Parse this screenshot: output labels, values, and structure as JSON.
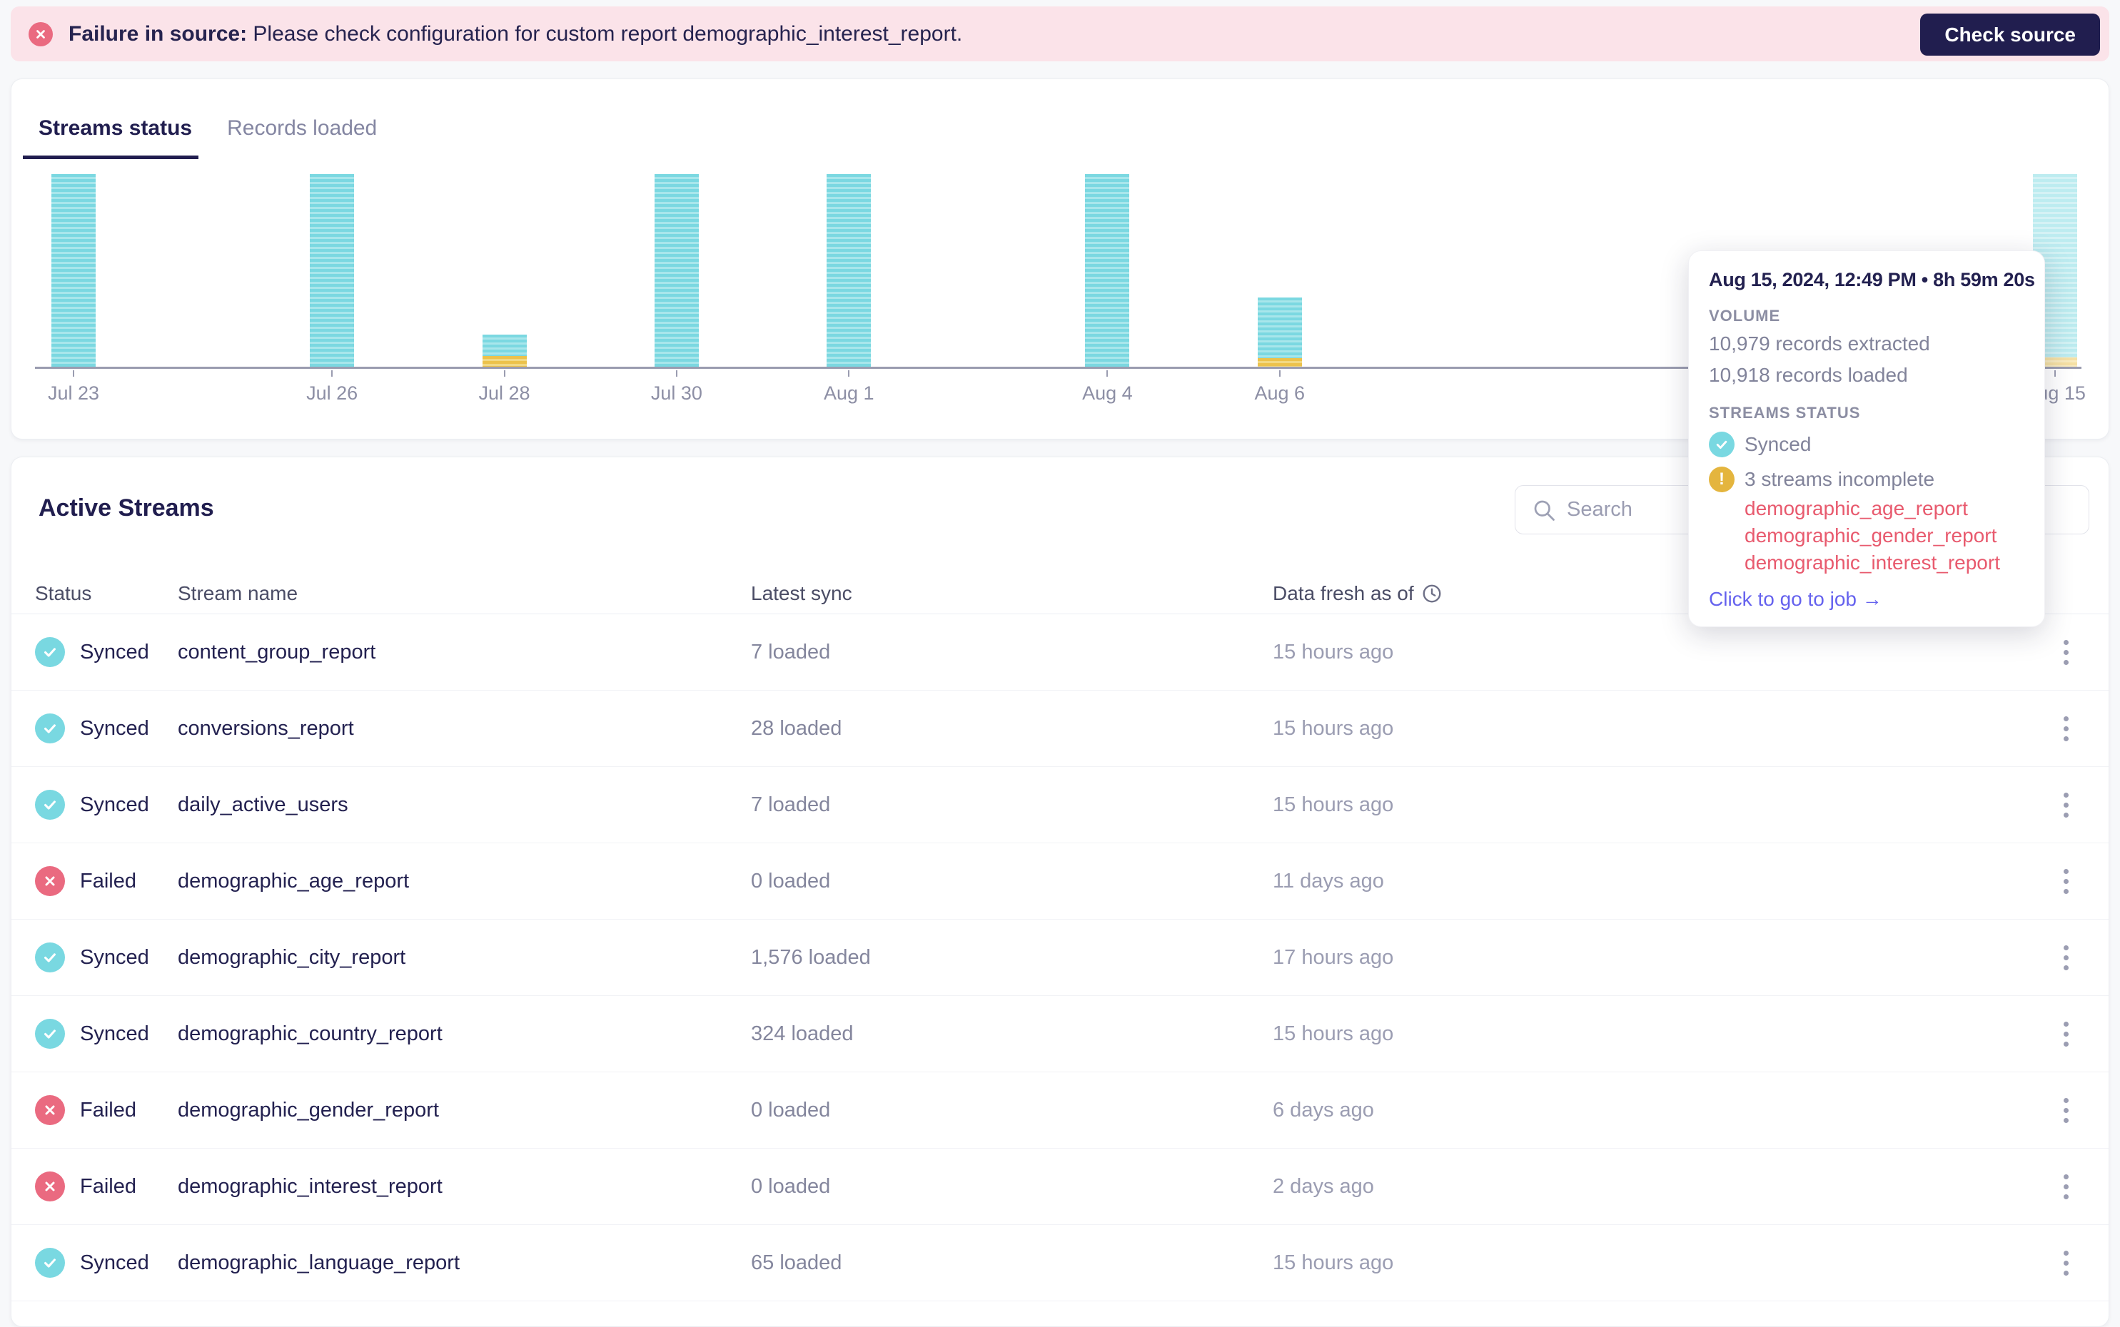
{
  "colors": {
    "accent_navy": "#211e4f",
    "error_pink_bg": "#fbe3e9",
    "error_red": "#ea6a80",
    "synced_teal": "#79d8e1",
    "bar_teal": "#7bd8e1",
    "bar_incomplete_yellow": "#ecc24c",
    "warning_amber": "#e4b53e",
    "failed_stream_red": "#e85a6e",
    "job_link_indigo": "#6562ee"
  },
  "banner": {
    "message_bold": "Failure in source:",
    "message_rest": " Please check configuration for custom report demographic_interest_report.",
    "button_label": "Check source"
  },
  "chart_card": {
    "tabs": [
      {
        "label": "Streams status",
        "active": true
      },
      {
        "label": "Records loaded",
        "active": false
      }
    ]
  },
  "chart_data": {
    "type": "bar",
    "title": "Streams status",
    "xlabel": "",
    "ylabel": "",
    "ylim_pct": [
      0,
      100
    ],
    "grid": "none",
    "legend": "none",
    "categories": [
      "Jul 23",
      "Jul 26",
      "Jul 28",
      "Jul 30",
      "Aug 1",
      "Aug 4",
      "Aug 6",
      "Aug 15"
    ],
    "series": [
      {
        "name": "synced",
        "values_pct": [
          100,
          100,
          11,
          100,
          100,
          100,
          31.5,
          95
        ]
      },
      {
        "name": "incomplete",
        "values_pct": [
          0,
          0,
          5.5,
          0,
          0,
          0,
          4.5,
          5
        ]
      }
    ],
    "bars": [
      {
        "label": "Jul 23",
        "day": 0,
        "synced_pct": 100,
        "incomplete_pct": 0,
        "faded": false
      },
      {
        "label": "Jul 26",
        "day": 3,
        "synced_pct": 100,
        "incomplete_pct": 0,
        "faded": false
      },
      {
        "label": "Jul 28",
        "day": 5,
        "synced_pct": 11,
        "incomplete_pct": 5.5,
        "faded": false
      },
      {
        "label": "Jul 30",
        "day": 7,
        "synced_pct": 100,
        "incomplete_pct": 0,
        "faded": false
      },
      {
        "label": "Aug 1",
        "day": 9,
        "synced_pct": 100,
        "incomplete_pct": 0,
        "faded": false
      },
      {
        "label": "Aug 4",
        "day": 12,
        "synced_pct": 100,
        "incomplete_pct": 0,
        "faded": false
      },
      {
        "label": "Aug 6",
        "day": 14,
        "synced_pct": 31.5,
        "incomplete_pct": 4.5,
        "faded": false
      },
      {
        "label": "Aug 15",
        "day": 23,
        "synced_pct": 95,
        "incomplete_pct": 5,
        "faded": true
      }
    ]
  },
  "tooltip": {
    "title": "Aug 15, 2024, 12:49 PM • 8h 59m 20s",
    "volume_label": "VOLUME",
    "volume_lines": [
      "10,979 records extracted",
      "10,918 records loaded"
    ],
    "streams_status_label": "STREAMS STATUS",
    "synced_label": "Synced",
    "incomplete_label": "3 streams incomplete",
    "incomplete_streams": [
      "demographic_age_report",
      "demographic_gender_report",
      "demographic_interest_report"
    ],
    "link_label": "Click to go to job →"
  },
  "streams": {
    "title": "Active Streams",
    "search_placeholder": "Search",
    "columns": [
      "Status",
      "Stream name",
      "Latest sync",
      "Data fresh as of"
    ],
    "rows": [
      {
        "state": "synced",
        "status": "Synced",
        "name": "content_group_report",
        "latest": "7 loaded",
        "fresh": "15 hours ago"
      },
      {
        "state": "synced",
        "status": "Synced",
        "name": "conversions_report",
        "latest": "28 loaded",
        "fresh": "15 hours ago"
      },
      {
        "state": "synced",
        "status": "Synced",
        "name": "daily_active_users",
        "latest": "7 loaded",
        "fresh": "15 hours ago"
      },
      {
        "state": "failed",
        "status": "Failed",
        "name": "demographic_age_report",
        "latest": "0 loaded",
        "fresh": "11 days ago"
      },
      {
        "state": "synced",
        "status": "Synced",
        "name": "demographic_city_report",
        "latest": "1,576 loaded",
        "fresh": "17 hours ago"
      },
      {
        "state": "synced",
        "status": "Synced",
        "name": "demographic_country_report",
        "latest": "324 loaded",
        "fresh": "15 hours ago"
      },
      {
        "state": "failed",
        "status": "Failed",
        "name": "demographic_gender_report",
        "latest": "0 loaded",
        "fresh": "6 days ago"
      },
      {
        "state": "failed",
        "status": "Failed",
        "name": "demographic_interest_report",
        "latest": "0 loaded",
        "fresh": "2 days ago"
      },
      {
        "state": "synced",
        "status": "Synced",
        "name": "demographic_language_report",
        "latest": "65 loaded",
        "fresh": "15 hours ago"
      }
    ]
  }
}
